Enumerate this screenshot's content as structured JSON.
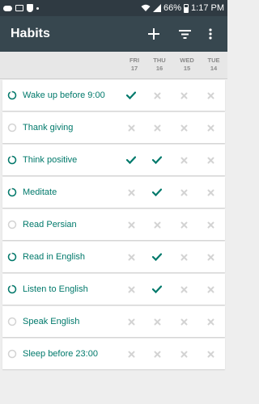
{
  "status_bar": {
    "battery": "66%",
    "time": "1:17 PM"
  },
  "app_bar": {
    "title": "Habits",
    "actions": [
      "add-icon",
      "filter-icon",
      "overflow-menu-icon"
    ]
  },
  "days": [
    {
      "weekday": "FRI",
      "date": "17"
    },
    {
      "weekday": "THU",
      "date": "16"
    },
    {
      "weekday": "WED",
      "date": "15"
    },
    {
      "weekday": "TUE",
      "date": "14"
    }
  ],
  "colors": {
    "accent": "#00796b",
    "unchecked": "#d3d3d3",
    "app_bar": "#37474f"
  },
  "habits": [
    {
      "name": "Wake up before 9:00",
      "progress": 0.9,
      "marks": [
        true,
        false,
        false,
        false
      ]
    },
    {
      "name": "Thank giving",
      "progress": 0,
      "marks": [
        false,
        false,
        false,
        false
      ]
    },
    {
      "name": "Think positive",
      "progress": 0.9,
      "marks": [
        true,
        true,
        false,
        false
      ]
    },
    {
      "name": "Meditate",
      "progress": 0.9,
      "marks": [
        false,
        true,
        false,
        false
      ]
    },
    {
      "name": "Read Persian",
      "progress": 0,
      "marks": [
        false,
        false,
        false,
        false
      ]
    },
    {
      "name": "Read in English",
      "progress": 0.9,
      "marks": [
        false,
        true,
        false,
        false
      ]
    },
    {
      "name": "Listen to English",
      "progress": 0.9,
      "marks": [
        false,
        true,
        false,
        false
      ]
    },
    {
      "name": "Speak English",
      "progress": 0,
      "marks": [
        false,
        false,
        false,
        false
      ]
    },
    {
      "name": "Sleep before 23:00",
      "progress": 0,
      "marks": [
        false,
        false,
        false,
        false
      ]
    }
  ]
}
